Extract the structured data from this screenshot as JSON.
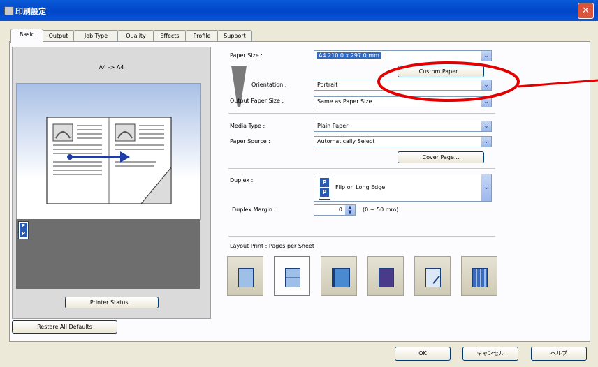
{
  "window": {
    "title": "印刷設定",
    "close_glyph": "✕"
  },
  "tabs": [
    "Basic",
    "Output",
    "Job Type",
    "Quality",
    "Effects",
    "Profile",
    "Support"
  ],
  "preview": {
    "label": "A4 -> A4",
    "duplex_icon": [
      "P",
      "P"
    ],
    "printer_status_label": "Printer Status..."
  },
  "basic": {
    "paper_size_label": "Paper Size :",
    "paper_size_value": "A4  210.0 x 297.0 mm",
    "custom_paper_label": "Custom Paper...",
    "orientation_label": "Orientation :",
    "orientation_value": "Portrait",
    "output_paper_size_label": "Output Paper Size :",
    "output_paper_size_value": "Same as Paper Size",
    "media_type_label": "Media Type :",
    "media_type_value": "Plain Paper",
    "paper_source_label": "Paper Source :",
    "paper_source_value": "Automatically Select",
    "cover_page_label": "Cover Page...",
    "duplex_label": "Duplex :",
    "duplex_value": "Flip on Long Edge",
    "duplex_margin_label": "Duplex Margin :",
    "duplex_margin_value": "0",
    "duplex_margin_range": "(0 ~ 50 mm)",
    "layout_print_label": "Layout Print : Pages per Sheet",
    "restore_defaults_label": "Restore All Defaults"
  },
  "footer": {
    "ok_label": "OK",
    "cancel_label": "キャンセル",
    "help_label": "ヘルプ"
  },
  "colors": {
    "annotation": "#e00000",
    "title_bar": "#0046c8"
  }
}
